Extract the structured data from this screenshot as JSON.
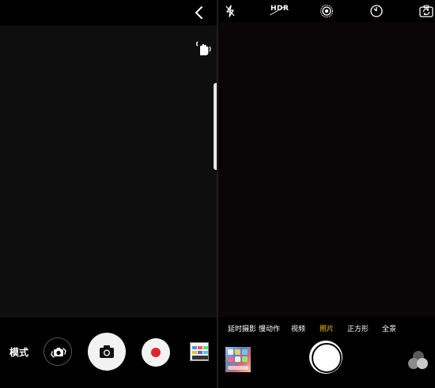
{
  "left_camera": {
    "mode_label": "模式",
    "icons": {
      "back": "chevron-left-icon",
      "gesture": "hand-wave-gesture-icon",
      "switch_camera": "switch-camera-icon",
      "shutter": "camera-icon",
      "record": "record-dot-icon"
    },
    "record_color": "#e0262b"
  },
  "right_camera": {
    "top_bar": {
      "hdr_label": "HDR",
      "icons": [
        "flash-off-icon",
        "live-photo-icon",
        "timer-icon",
        "flip-camera-icon"
      ]
    },
    "modes": [
      {
        "label": "延时摄影",
        "active": false
      },
      {
        "label": "慢动作",
        "active": false
      },
      {
        "label": "视频",
        "active": false
      },
      {
        "label": "照片",
        "active": true
      },
      {
        "label": "正方形",
        "active": false
      },
      {
        "label": "全景",
        "active": false
      }
    ],
    "active_mode_color": "#f5c41b"
  }
}
